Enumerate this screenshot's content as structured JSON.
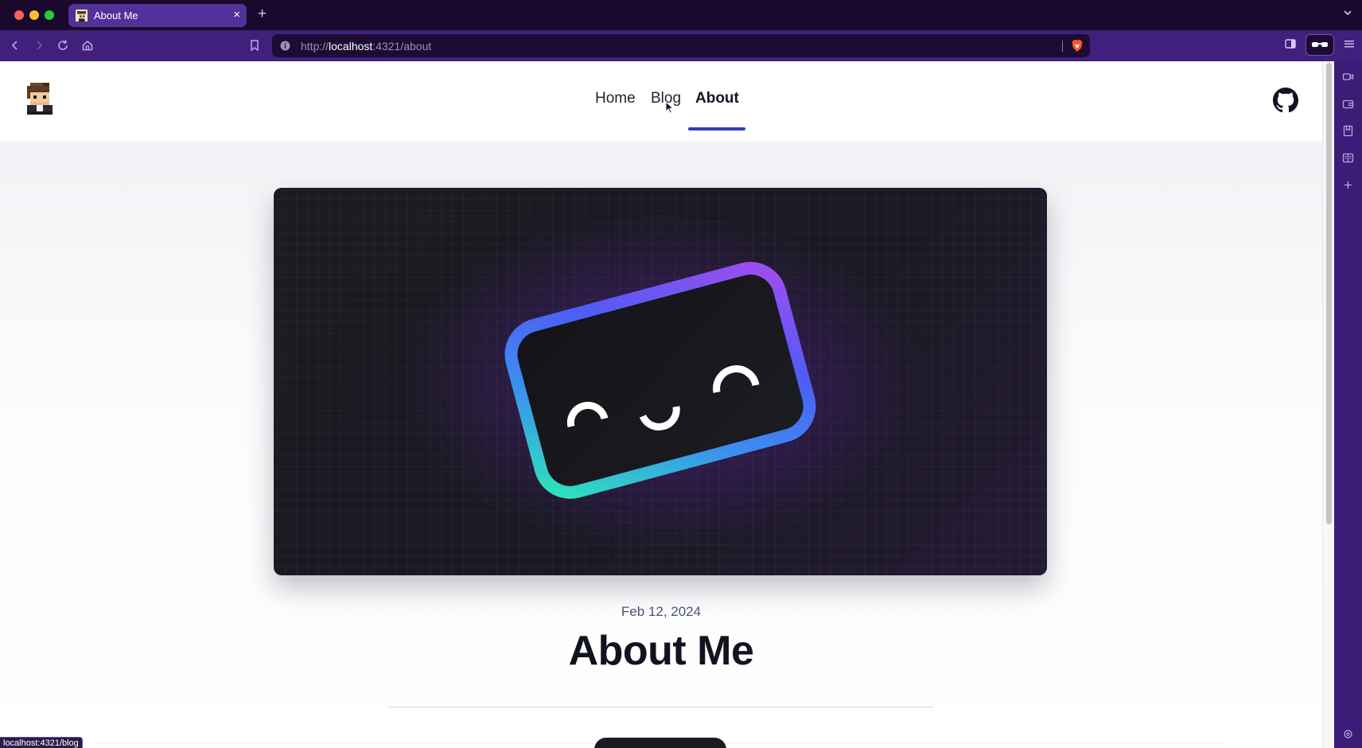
{
  "browser": {
    "tab": {
      "title": "About Me"
    },
    "address_bar": {
      "protocol": "http://",
      "host": "localhost",
      "path": ":4321/about"
    },
    "status_bar": {
      "text": "localhost:4321/blog"
    }
  },
  "site": {
    "nav": [
      {
        "label": "Home",
        "active": false
      },
      {
        "label": "Blog",
        "active": false
      },
      {
        "label": "About",
        "active": true
      }
    ],
    "accent_color": "#2f3bb8"
  },
  "post": {
    "date": "Feb 12, 2024",
    "title": "About Me"
  },
  "icons": {
    "logo": "pixel-avatar-icon",
    "github": "github-icon",
    "hero": "smiling-rounded-card-illustration"
  }
}
